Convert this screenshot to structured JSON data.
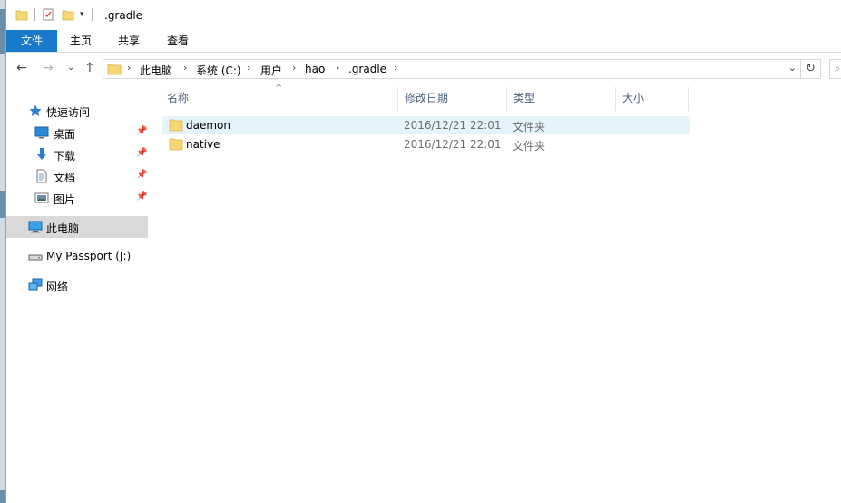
{
  "window": {
    "title": ".gradle"
  },
  "ribbon": {
    "tabs": [
      {
        "label": "文件",
        "active": true
      },
      {
        "label": "主页",
        "active": false
      },
      {
        "label": "共享",
        "active": false
      },
      {
        "label": "查看",
        "active": false
      }
    ]
  },
  "address": {
    "crumbs": [
      "此电脑",
      "系统 (C:)",
      "用户",
      "hao",
      ".gradle"
    ]
  },
  "sidebar": {
    "quick_access": "快速访问",
    "pinned": [
      {
        "label": "桌面",
        "icon": "desktop-icon"
      },
      {
        "label": "下载",
        "icon": "download-icon"
      },
      {
        "label": "文档",
        "icon": "document-icon"
      },
      {
        "label": "图片",
        "icon": "pictures-icon"
      }
    ],
    "this_pc": "此电脑",
    "drive": "My Passport (J:)",
    "network": "网络"
  },
  "columns": {
    "name": "名称",
    "modified": "修改日期",
    "type": "类型",
    "size": "大小"
  },
  "files": [
    {
      "name": "daemon",
      "modified": "2016/12/21 22:01",
      "type": "文件夹",
      "size": "",
      "selected": true
    },
    {
      "name": "native",
      "modified": "2016/12/21 22:01",
      "type": "文件夹",
      "size": "",
      "selected": false
    }
  ],
  "colors": {
    "accent": "#1979ca",
    "selection": "#e5f3fb",
    "nav_selected": "#d9d9d9",
    "folder": "#f7d774"
  }
}
